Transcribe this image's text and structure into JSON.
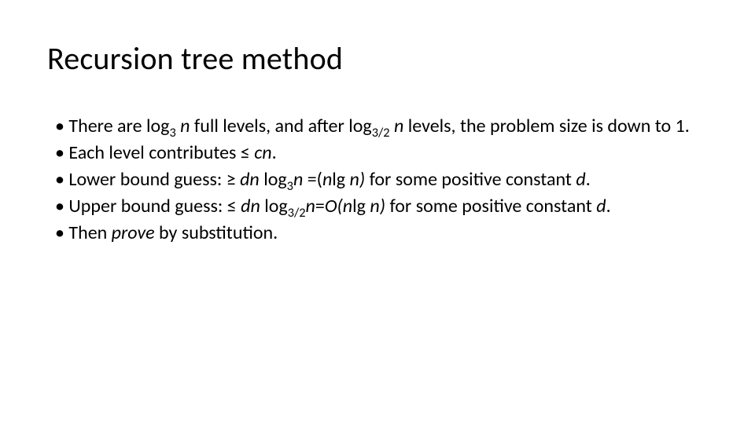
{
  "title": "Recursion tree method",
  "bullets": {
    "b1": {
      "pre": "There are log",
      "sub1": "3",
      "mid1": " ",
      "n1": "n",
      "mid2": " full levels, and after log",
      "sub2": "3/2",
      "mid3": " ",
      "n2": "n",
      "tail": " levels, the problem size is down to 1."
    },
    "b2": {
      "pre": "Each level contributes ≤ ",
      "cn": "cn",
      "tail": "."
    },
    "b3": {
      "pre": "Lower bound guess: ≥ ",
      "dn": "dn",
      "mid1": " log",
      "sub1": "3",
      "n1": "n",
      "eq": " =(",
      "nlg_n": "n",
      "lg": "lg ",
      "nlg_n2": "n)",
      "mid2": " for some positive constant ",
      "d": "d",
      "tail": "."
    },
    "b4": {
      "pre": "Upper bound guess: ≤ ",
      "dn": "dn",
      "mid1": " log",
      "sub1": "3/2",
      "n1": "n",
      "eq": "=",
      "O": "O(n",
      "lg": "lg ",
      "n2": "n)",
      "mid2": " for some positive constant ",
      "d": "d",
      "tail": "."
    },
    "b5": {
      "pre": "Then ",
      "prove": "prove",
      "tail": " by substitution."
    }
  }
}
